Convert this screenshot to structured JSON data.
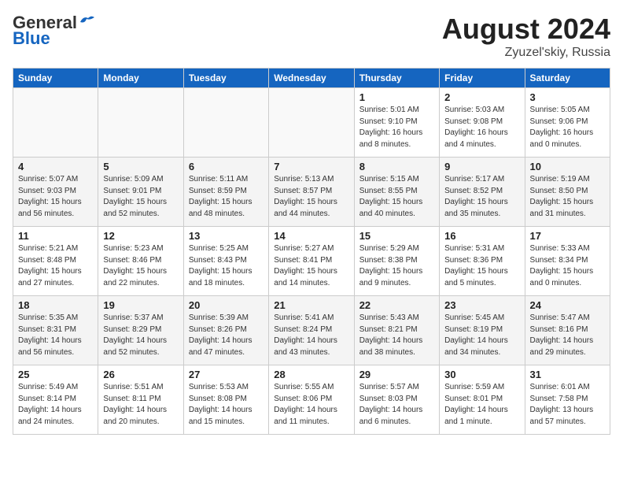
{
  "header": {
    "logo_general": "General",
    "logo_blue": "Blue",
    "month_title": "August 2024",
    "location": "Zyuzel'skiy, Russia"
  },
  "weekdays": [
    "Sunday",
    "Monday",
    "Tuesday",
    "Wednesday",
    "Thursday",
    "Friday",
    "Saturday"
  ],
  "weeks": [
    [
      {
        "day": "",
        "info": ""
      },
      {
        "day": "",
        "info": ""
      },
      {
        "day": "",
        "info": ""
      },
      {
        "day": "",
        "info": ""
      },
      {
        "day": "1",
        "info": "Sunrise: 5:01 AM\nSunset: 9:10 PM\nDaylight: 16 hours\nand 8 minutes."
      },
      {
        "day": "2",
        "info": "Sunrise: 5:03 AM\nSunset: 9:08 PM\nDaylight: 16 hours\nand 4 minutes."
      },
      {
        "day": "3",
        "info": "Sunrise: 5:05 AM\nSunset: 9:06 PM\nDaylight: 16 hours\nand 0 minutes."
      }
    ],
    [
      {
        "day": "4",
        "info": "Sunrise: 5:07 AM\nSunset: 9:03 PM\nDaylight: 15 hours\nand 56 minutes."
      },
      {
        "day": "5",
        "info": "Sunrise: 5:09 AM\nSunset: 9:01 PM\nDaylight: 15 hours\nand 52 minutes."
      },
      {
        "day": "6",
        "info": "Sunrise: 5:11 AM\nSunset: 8:59 PM\nDaylight: 15 hours\nand 48 minutes."
      },
      {
        "day": "7",
        "info": "Sunrise: 5:13 AM\nSunset: 8:57 PM\nDaylight: 15 hours\nand 44 minutes."
      },
      {
        "day": "8",
        "info": "Sunrise: 5:15 AM\nSunset: 8:55 PM\nDaylight: 15 hours\nand 40 minutes."
      },
      {
        "day": "9",
        "info": "Sunrise: 5:17 AM\nSunset: 8:52 PM\nDaylight: 15 hours\nand 35 minutes."
      },
      {
        "day": "10",
        "info": "Sunrise: 5:19 AM\nSunset: 8:50 PM\nDaylight: 15 hours\nand 31 minutes."
      }
    ],
    [
      {
        "day": "11",
        "info": "Sunrise: 5:21 AM\nSunset: 8:48 PM\nDaylight: 15 hours\nand 27 minutes."
      },
      {
        "day": "12",
        "info": "Sunrise: 5:23 AM\nSunset: 8:46 PM\nDaylight: 15 hours\nand 22 minutes."
      },
      {
        "day": "13",
        "info": "Sunrise: 5:25 AM\nSunset: 8:43 PM\nDaylight: 15 hours\nand 18 minutes."
      },
      {
        "day": "14",
        "info": "Sunrise: 5:27 AM\nSunset: 8:41 PM\nDaylight: 15 hours\nand 14 minutes."
      },
      {
        "day": "15",
        "info": "Sunrise: 5:29 AM\nSunset: 8:38 PM\nDaylight: 15 hours\nand 9 minutes."
      },
      {
        "day": "16",
        "info": "Sunrise: 5:31 AM\nSunset: 8:36 PM\nDaylight: 15 hours\nand 5 minutes."
      },
      {
        "day": "17",
        "info": "Sunrise: 5:33 AM\nSunset: 8:34 PM\nDaylight: 15 hours\nand 0 minutes."
      }
    ],
    [
      {
        "day": "18",
        "info": "Sunrise: 5:35 AM\nSunset: 8:31 PM\nDaylight: 14 hours\nand 56 minutes."
      },
      {
        "day": "19",
        "info": "Sunrise: 5:37 AM\nSunset: 8:29 PM\nDaylight: 14 hours\nand 52 minutes."
      },
      {
        "day": "20",
        "info": "Sunrise: 5:39 AM\nSunset: 8:26 PM\nDaylight: 14 hours\nand 47 minutes."
      },
      {
        "day": "21",
        "info": "Sunrise: 5:41 AM\nSunset: 8:24 PM\nDaylight: 14 hours\nand 43 minutes."
      },
      {
        "day": "22",
        "info": "Sunrise: 5:43 AM\nSunset: 8:21 PM\nDaylight: 14 hours\nand 38 minutes."
      },
      {
        "day": "23",
        "info": "Sunrise: 5:45 AM\nSunset: 8:19 PM\nDaylight: 14 hours\nand 34 minutes."
      },
      {
        "day": "24",
        "info": "Sunrise: 5:47 AM\nSunset: 8:16 PM\nDaylight: 14 hours\nand 29 minutes."
      }
    ],
    [
      {
        "day": "25",
        "info": "Sunrise: 5:49 AM\nSunset: 8:14 PM\nDaylight: 14 hours\nand 24 minutes."
      },
      {
        "day": "26",
        "info": "Sunrise: 5:51 AM\nSunset: 8:11 PM\nDaylight: 14 hours\nand 20 minutes."
      },
      {
        "day": "27",
        "info": "Sunrise: 5:53 AM\nSunset: 8:08 PM\nDaylight: 14 hours\nand 15 minutes."
      },
      {
        "day": "28",
        "info": "Sunrise: 5:55 AM\nSunset: 8:06 PM\nDaylight: 14 hours\nand 11 minutes."
      },
      {
        "day": "29",
        "info": "Sunrise: 5:57 AM\nSunset: 8:03 PM\nDaylight: 14 hours\nand 6 minutes."
      },
      {
        "day": "30",
        "info": "Sunrise: 5:59 AM\nSunset: 8:01 PM\nDaylight: 14 hours\nand 1 minute."
      },
      {
        "day": "31",
        "info": "Sunrise: 6:01 AM\nSunset: 7:58 PM\nDaylight: 13 hours\nand 57 minutes."
      }
    ]
  ]
}
